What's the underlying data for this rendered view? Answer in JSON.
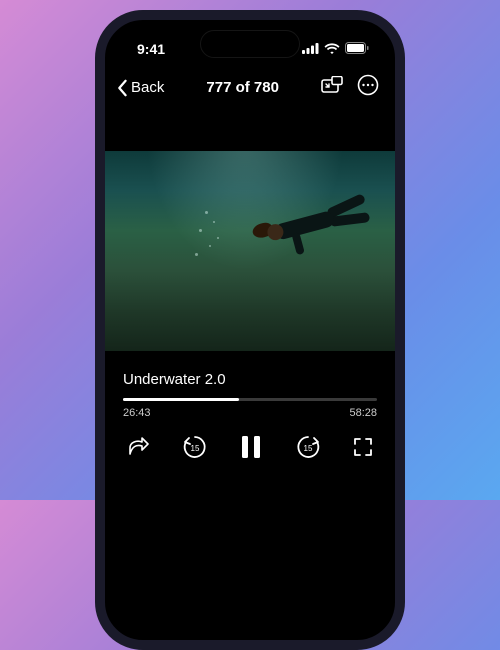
{
  "status": {
    "time": "9:41"
  },
  "nav": {
    "back_label": "Back",
    "title": "777 of 780"
  },
  "video": {
    "title": "Underwater 2.0",
    "elapsed": "26:43",
    "duration": "58:28",
    "progress_pct": 45.8
  },
  "skip": {
    "back": "15",
    "fwd": "15"
  }
}
